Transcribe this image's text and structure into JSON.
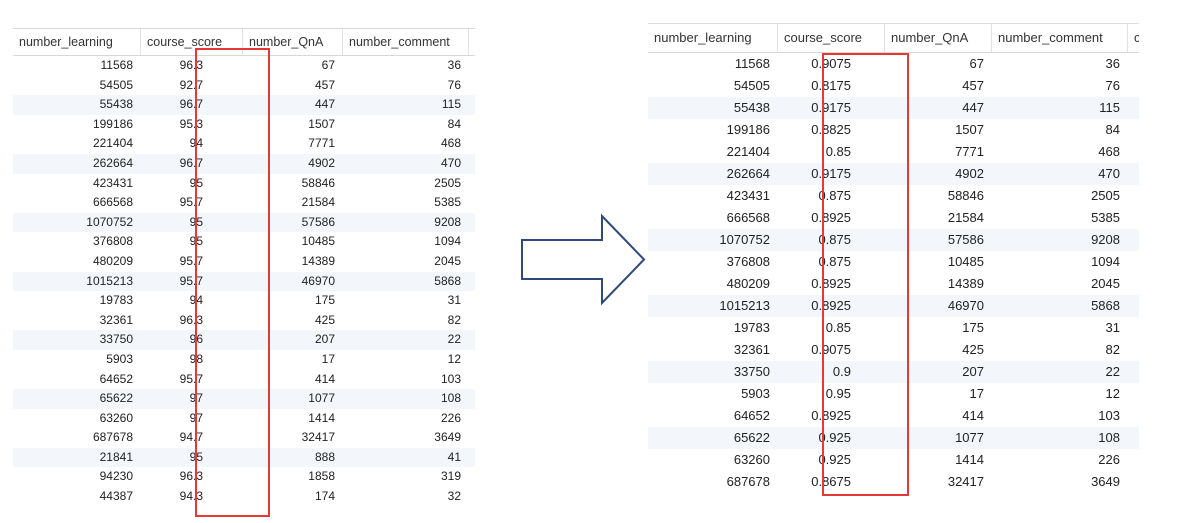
{
  "colors": {
    "highlight": "#e53935",
    "arrow_stroke": "#2f4a7a",
    "row_alt": "#f3f7fb"
  },
  "left_table": {
    "headers": [
      "number_learning",
      "course_score",
      "number_QnA",
      "number_comment",
      "c"
    ],
    "rows": [
      [
        "11568",
        "96.3",
        "67",
        "36"
      ],
      [
        "54505",
        "92.7",
        "457",
        "76"
      ],
      [
        "55438",
        "96.7",
        "447",
        "115"
      ],
      [
        "199186",
        "95.3",
        "1507",
        "84"
      ],
      [
        "221404",
        "94",
        "7771",
        "468"
      ],
      [
        "262664",
        "96.7",
        "4902",
        "470"
      ],
      [
        "423431",
        "95",
        "58846",
        "2505"
      ],
      [
        "666568",
        "95.7",
        "21584",
        "5385"
      ],
      [
        "1070752",
        "95",
        "57586",
        "9208"
      ],
      [
        "376808",
        "95",
        "10485",
        "1094"
      ],
      [
        "480209",
        "95.7",
        "14389",
        "2045"
      ],
      [
        "1015213",
        "95.7",
        "46970",
        "5868"
      ],
      [
        "19783",
        "94",
        "175",
        "31"
      ],
      [
        "32361",
        "96.3",
        "425",
        "82"
      ],
      [
        "33750",
        "96",
        "207",
        "22"
      ],
      [
        "5903",
        "98",
        "17",
        "12"
      ],
      [
        "64652",
        "95.7",
        "414",
        "103"
      ],
      [
        "65622",
        "97",
        "1077",
        "108"
      ],
      [
        "63260",
        "97",
        "1414",
        "226"
      ],
      [
        "687678",
        "94.7",
        "32417",
        "3649"
      ],
      [
        "21841",
        "95",
        "888",
        "41"
      ],
      [
        "94230",
        "96.3",
        "1858",
        "319"
      ],
      [
        "44387",
        "94.3",
        "174",
        "32"
      ]
    ]
  },
  "right_table": {
    "headers": [
      "number_learning",
      "course_score",
      "number_QnA",
      "number_comment",
      "co"
    ],
    "rows": [
      [
        "11568",
        "0.9075",
        "67",
        "36"
      ],
      [
        "54505",
        "0.8175",
        "457",
        "76"
      ],
      [
        "55438",
        "0.9175",
        "447",
        "115"
      ],
      [
        "199186",
        "0.8825",
        "1507",
        "84"
      ],
      [
        "221404",
        "0.85",
        "7771",
        "468"
      ],
      [
        "262664",
        "0.9175",
        "4902",
        "470"
      ],
      [
        "423431",
        "0.875",
        "58846",
        "2505"
      ],
      [
        "666568",
        "0.8925",
        "21584",
        "5385"
      ],
      [
        "1070752",
        "0.875",
        "57586",
        "9208"
      ],
      [
        "376808",
        "0.875",
        "10485",
        "1094"
      ],
      [
        "480209",
        "0.8925",
        "14389",
        "2045"
      ],
      [
        "1015213",
        "0.8925",
        "46970",
        "5868"
      ],
      [
        "19783",
        "0.85",
        "175",
        "31"
      ],
      [
        "32361",
        "0.9075",
        "425",
        "82"
      ],
      [
        "33750",
        "0.9",
        "207",
        "22"
      ],
      [
        "5903",
        "0.95",
        "17",
        "12"
      ],
      [
        "64652",
        "0.8925",
        "414",
        "103"
      ],
      [
        "65622",
        "0.925",
        "1077",
        "108"
      ],
      [
        "63260",
        "0.925",
        "1414",
        "226"
      ],
      [
        "687678",
        "0.8675",
        "32417",
        "3649"
      ]
    ]
  },
  "arrow_icon": "right-arrow-icon"
}
